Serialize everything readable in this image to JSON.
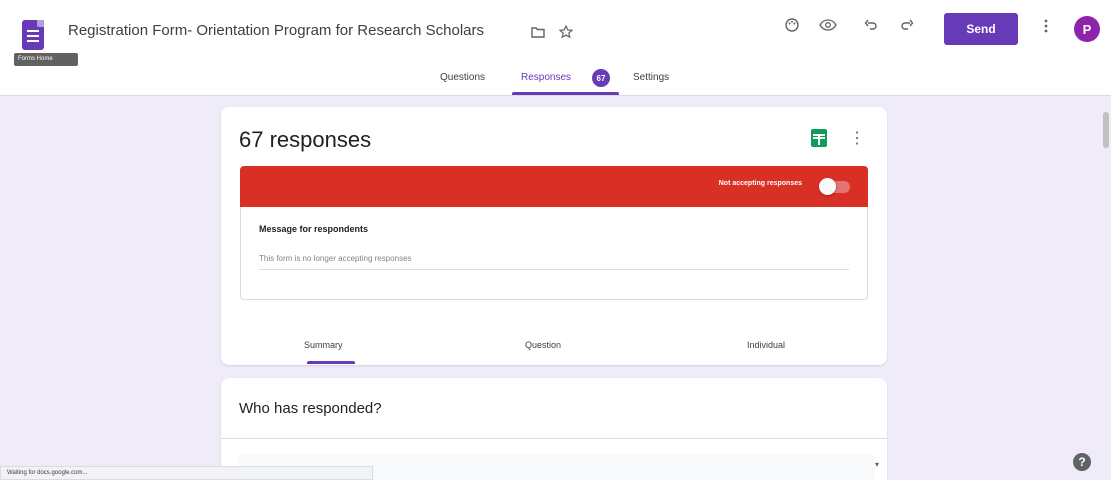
{
  "header": {
    "form_title": "Registration Form- Orientation Program for Research Scholars",
    "tooltip": "Forms Home",
    "send_label": "Send",
    "avatar_letter": "P"
  },
  "tabs": [
    {
      "label": "Questions"
    },
    {
      "label": "Responses",
      "badge": "67"
    },
    {
      "label": "Settings"
    }
  ],
  "responses": {
    "count_title": "67 responses",
    "not_accepting_label": "Not accepting responses",
    "accepting": false,
    "message_label": "Message for respondents",
    "message_value": "This form is no longer accepting responses"
  },
  "subtabs": [
    {
      "label": "Summary"
    },
    {
      "label": "Question"
    },
    {
      "label": "Individual"
    }
  ],
  "summary": {
    "who_heading": "Who has responded?"
  },
  "statusbar": {
    "text": "Waiting for docs.google.com..."
  },
  "colors": {
    "accent": "#673ab7",
    "closed_banner": "#d93025",
    "background": "#f0ebf8"
  }
}
